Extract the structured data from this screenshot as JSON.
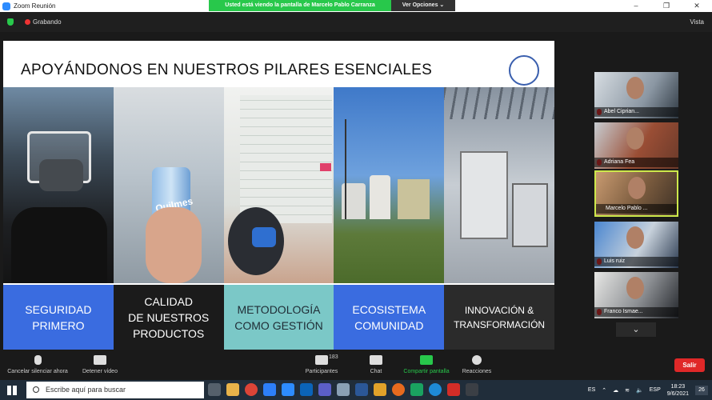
{
  "window": {
    "title": "Zoom Reunión",
    "minimize": "–",
    "maximize": "❐",
    "close": "✕"
  },
  "share_banner": {
    "message": "Usted está viendo la pantalla de Marcelo Pablo Carranza",
    "options": "Ver Opciones ⌄"
  },
  "meeting": {
    "recording": "Grabando",
    "view": "Vista"
  },
  "slide": {
    "title": "APOYÁNDONOS EN NUESTROS PILARES ESENCIALES",
    "pillars": [
      {
        "label": "SEGURIDAD\nPRIMERO",
        "color": "#3a6ce0"
      },
      {
        "label": "CALIDAD\nDE NUESTROS\nPRODUCTOS",
        "color": "#1b1b1b"
      },
      {
        "label": "METODOLOGÍA\nCOMO GESTIÓN",
        "color": "#7bc8c7"
      },
      {
        "label": "ECOSISTEMA\nCOMUNIDAD",
        "color": "#3a6ce0"
      },
      {
        "label": "INNOVACIÓN &\nTRANSFORMACIÓN",
        "color": "#2b2b2b"
      }
    ],
    "can_text": "Quilmes"
  },
  "participants": [
    "Abel Ciprian...",
    "Adriana Fea",
    "Marcelo Pablo ...",
    "Luis ruiz",
    "Franco Ismae..."
  ],
  "toolbar": {
    "mute": "Cancelar silenciar ahora",
    "video": "Detener vídeo",
    "participants": "Participantes",
    "participants_count": "183",
    "chat": "Chat",
    "share": "Compartir pantalla",
    "reactions": "Reacciones",
    "leave": "Salir"
  },
  "taskbar": {
    "search_placeholder": "Escribe aquí para buscar",
    "lang": "ES",
    "kbd": "ESP",
    "time": "18:23",
    "date": "9/6/2021",
    "notifications": "26"
  }
}
